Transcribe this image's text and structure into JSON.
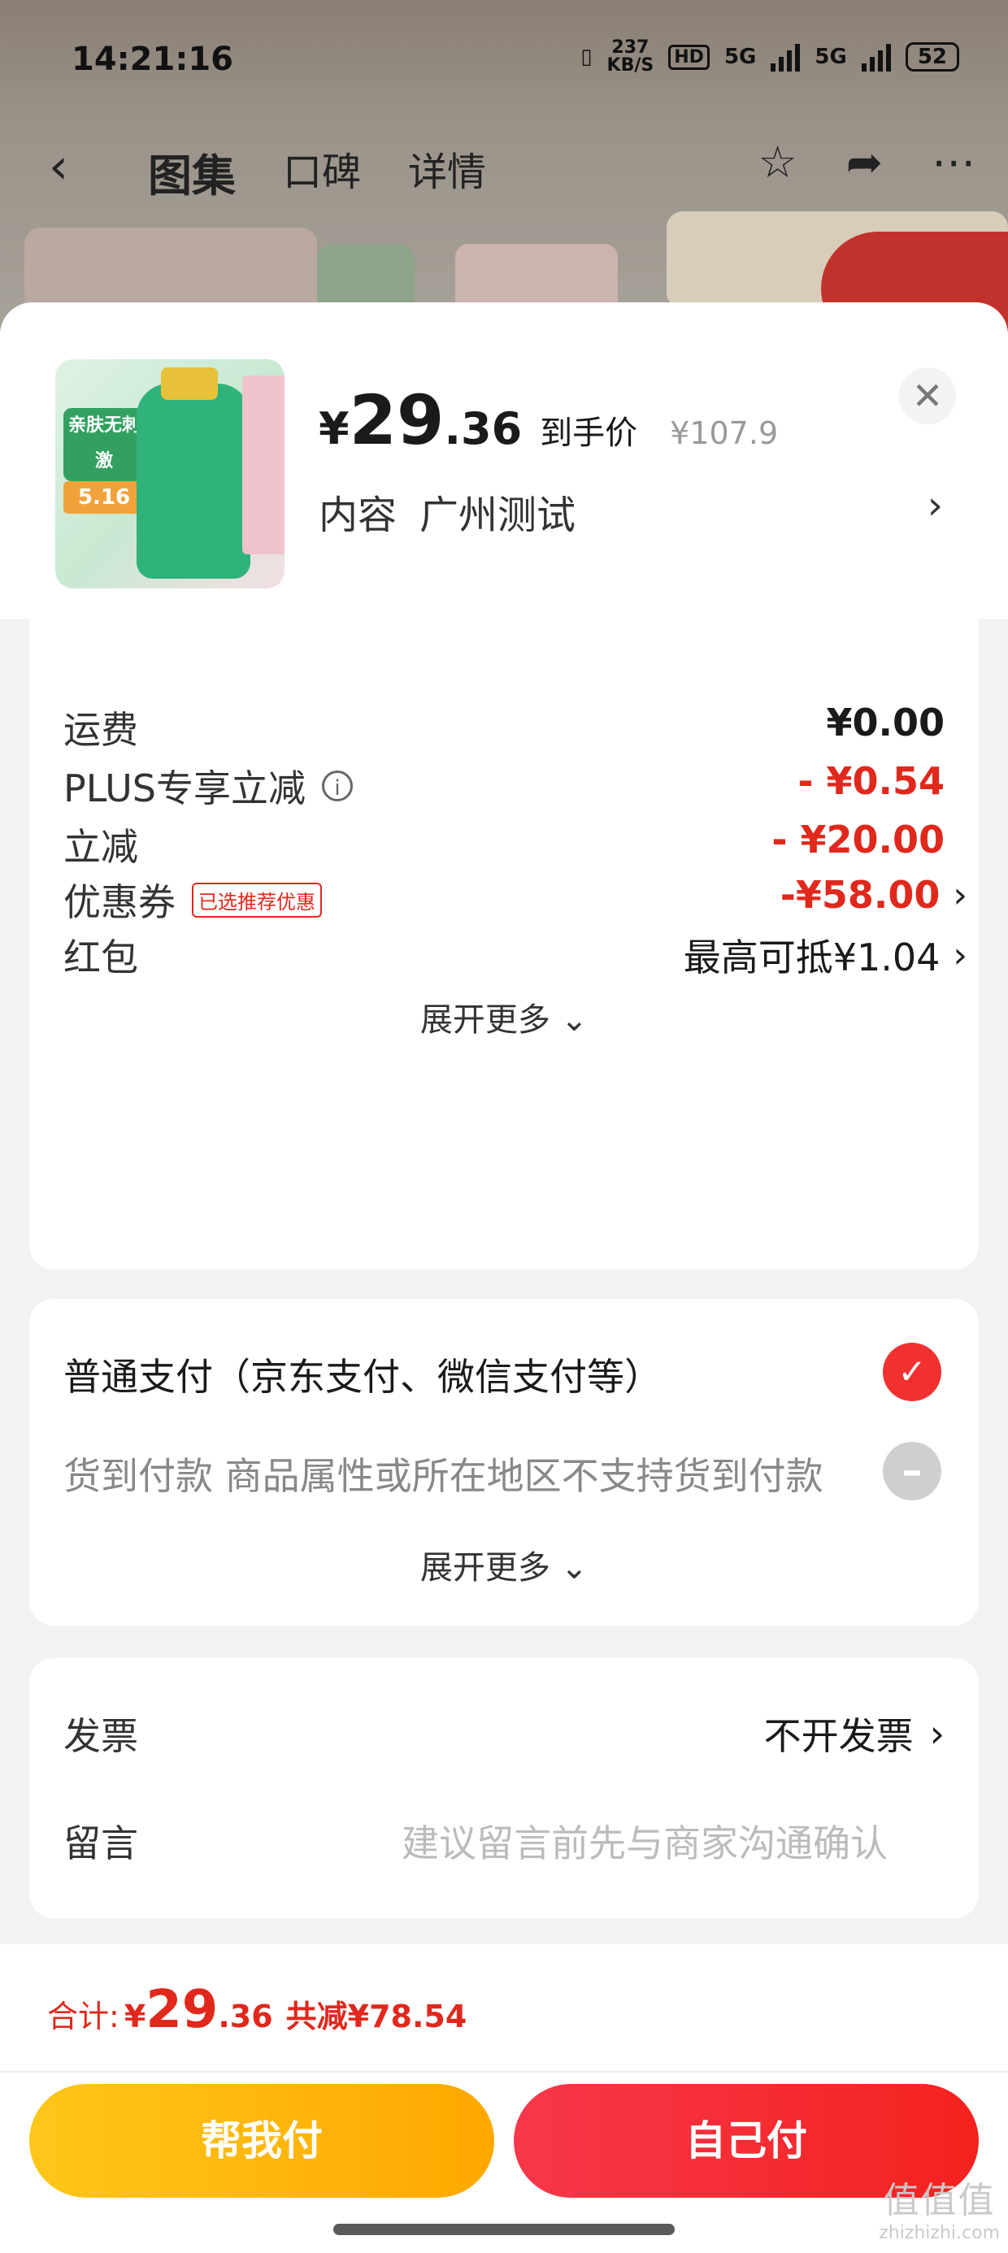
{
  "status_bar": {
    "time": "14:21:16",
    "net_speed_value": "237",
    "net_speed_unit": "KB/S",
    "hd": "HD",
    "sim1": "5G",
    "sim2": "5G",
    "battery": "52"
  },
  "nav": {
    "tabs": [
      "图集",
      "口碑",
      "详情"
    ],
    "active_tab": "图集"
  },
  "product": {
    "thumb_badge": "亲肤无刺激",
    "thumb_date": "5.16",
    "price_symbol": "¥",
    "price_int": "29",
    "price_dec": ".36",
    "price_tag": "到手价",
    "original_price": "¥107.9",
    "spec_label": "内容",
    "spec_value": "广州测试"
  },
  "price_details": {
    "shipping_label": "运费",
    "shipping_value": "¥0.00",
    "plus_label": "PLUS专享立减",
    "plus_value": "- ¥0.54",
    "discount_label": "立减",
    "discount_value": "- ¥20.00",
    "coupon_label": "优惠券",
    "coupon_tag": "已选推荐优惠",
    "coupon_value": "-¥58.00",
    "redpacket_label": "红包",
    "redpacket_value": "最高可抵¥1.04",
    "expand_more": "展开更多"
  },
  "payment": {
    "normal_pay": "普通支付（京东支付、微信支付等）",
    "cod": "货到付款 商品属性或所在地区不支持货到付款",
    "expand_more": "展开更多"
  },
  "extras": {
    "invoice_label": "发票",
    "invoice_value": "不开发票",
    "message_label": "留言",
    "message_placeholder": "建议留言前先与商家沟通确认"
  },
  "footer": {
    "total_label": "合计:",
    "total_yen": "¥",
    "total_int": "29",
    "total_dec": ".36",
    "total_saved": "共减¥78.54",
    "help_pay": "帮我付",
    "self_pay": "自己付"
  },
  "watermark": {
    "logo": "值值值",
    "site": "zhizhizhi.com"
  },
  "colors": {
    "accent_red": "#e0281c",
    "button_red": "#f4221e",
    "button_yellow": "#ffb400"
  }
}
